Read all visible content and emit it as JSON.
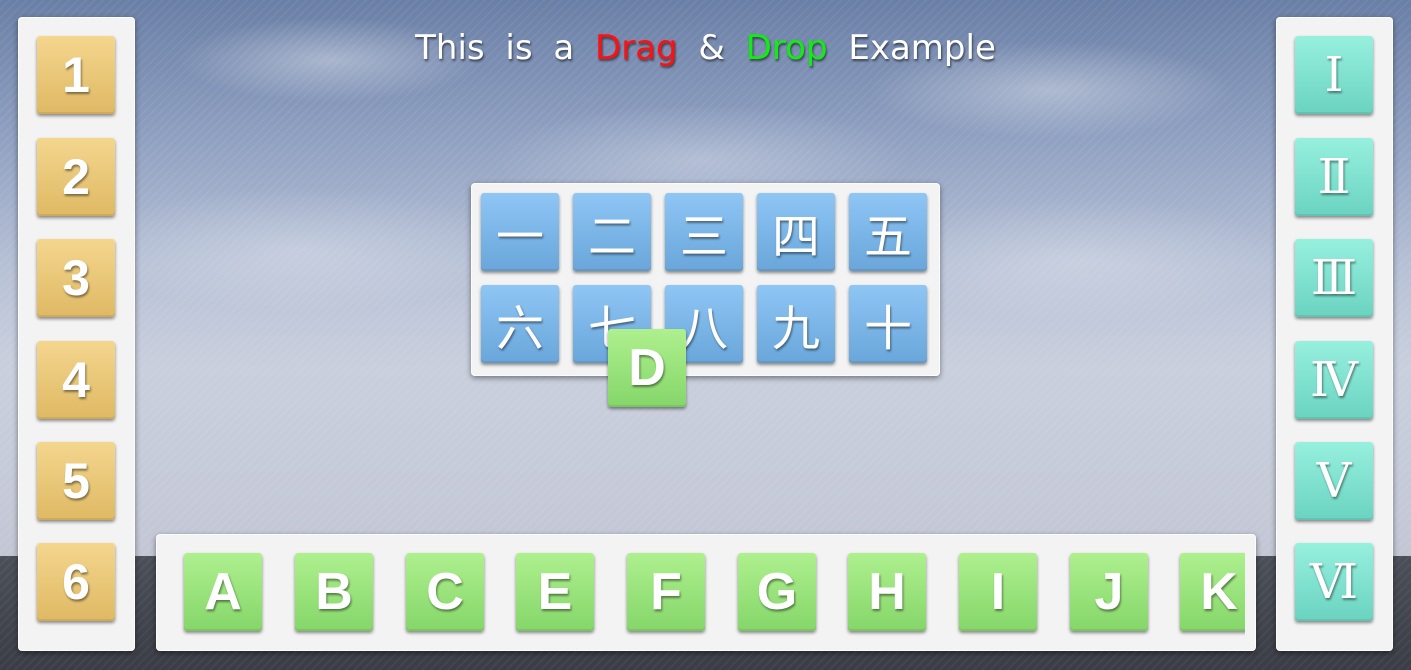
{
  "title": {
    "part1": "This is a",
    "drag": "Drag",
    "amp": "&",
    "drop": "Drop",
    "part2": "Example"
  },
  "colors": {
    "drag_word": "#ff1010",
    "drop_word": "#10ee10",
    "gold_tile": "#e8c676",
    "teal_tile": "#7fe0cd",
    "blue_tile": "#78b4e6",
    "green_tile": "#95e07a"
  },
  "left_tiles": [
    "1",
    "2",
    "3",
    "4",
    "5",
    "6"
  ],
  "right_tiles": [
    "Ⅰ",
    "Ⅱ",
    "Ⅲ",
    "Ⅳ",
    "Ⅴ",
    "Ⅵ"
  ],
  "center_tiles": [
    "一",
    "二",
    "三",
    "四",
    "五",
    "六",
    "七",
    "八",
    "九",
    "十"
  ],
  "bottom_tiles": [
    "A",
    "B",
    "C",
    "E",
    "F",
    "G",
    "H",
    "I",
    "J",
    "K"
  ],
  "dragged_tile": "D"
}
